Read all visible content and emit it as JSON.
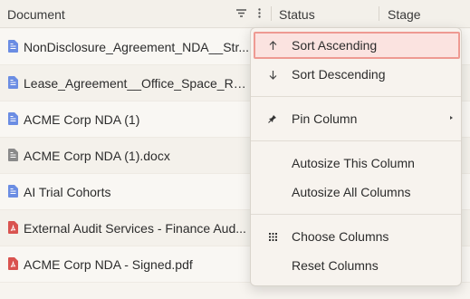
{
  "header": {
    "document_label": "Document",
    "status_label": "Status",
    "stage_label": "Stage",
    "filter_icon": "filter-icon",
    "menu_icon": "kebab-menu-icon"
  },
  "rows": [
    {
      "name": "NonDisclosure_Agreement_NDA__Str...",
      "file_type": "doc"
    },
    {
      "name": "Lease_Agreement__Office_Space_Re...",
      "file_type": "doc"
    },
    {
      "name": "ACME Corp NDA (1)",
      "file_type": "doc"
    },
    {
      "name": "ACME Corp NDA (1).docx",
      "file_type": "docx"
    },
    {
      "name": "AI Trial Cohorts",
      "file_type": "doc"
    },
    {
      "name": "External Audit Services - Finance Aud...",
      "file_type": "pdf"
    },
    {
      "name": "ACME Corp NDA - Signed.pdf",
      "file_type": "pdf"
    }
  ],
  "column_menu": {
    "sort_ascending": "Sort Ascending",
    "sort_descending": "Sort Descending",
    "pin_column": "Pin Column",
    "autosize_this": "Autosize This Column",
    "autosize_all": "Autosize All Columns",
    "choose_columns": "Choose Columns",
    "reset_columns": "Reset Columns",
    "highlighted_item": "Sort Ascending"
  },
  "colors": {
    "doc_icon": "#6b8de3",
    "docx_icon": "#8a8a8a",
    "pdf_icon": "#d9534f",
    "highlight_bg": "#fbe3e0",
    "highlight_border": "#ee9a92"
  }
}
